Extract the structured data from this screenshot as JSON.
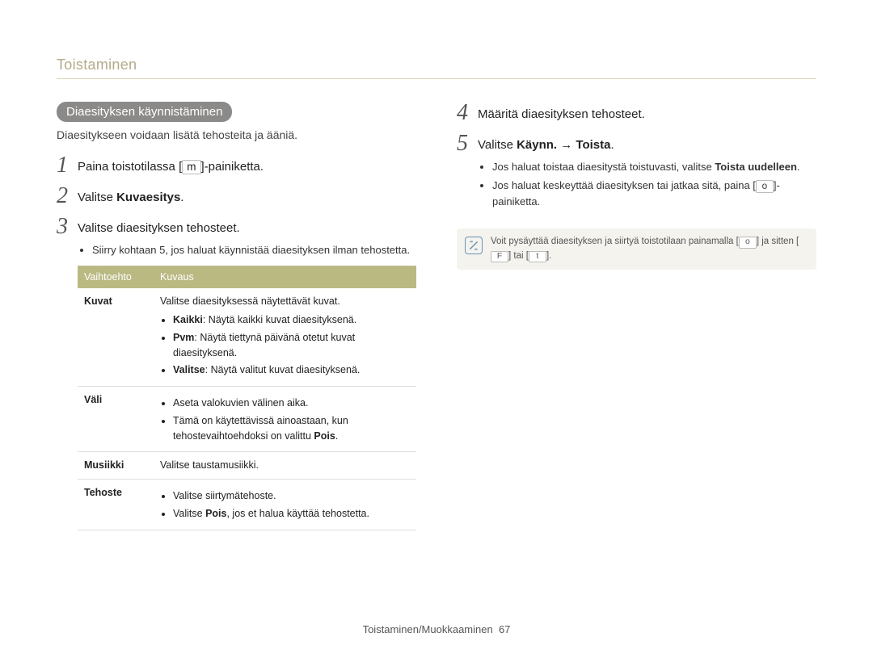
{
  "header": "Toistaminen",
  "left": {
    "pill": "Diaesityksen käynnistäminen",
    "intro": "Diaesitykseen voidaan lisätä tehosteita ja ääniä.",
    "step1_pre": "Paina toistotilassa [",
    "step1_key": "m",
    "step1_post": "]-painiketta.",
    "step2_pre": "Valitse ",
    "step2_bold": "Kuvaesitys",
    "step2_post": ".",
    "step3": "Valitse diaesityksen tehosteet.",
    "step3_bullet": "Siirry kohtaan 5, jos haluat käynnistää diaesityksen ilman tehostetta.",
    "table": {
      "head_option": "Vaihtoehto",
      "head_desc": "Kuvaus",
      "rows": [
        {
          "label": "Kuvat",
          "intro": "Valitse diaesityksessä näytettävät kuvat.",
          "items": [
            {
              "b": "Kaikki",
              "t": ": Näytä kaikki kuvat diaesityksenä."
            },
            {
              "b": "Pvm",
              "t": ": Näytä tiettynä päivänä otetut kuvat diaesityksenä."
            },
            {
              "b": "Valitse",
              "t": ": Näytä valitut kuvat diaesityksenä."
            }
          ]
        },
        {
          "label": "Väli",
          "items": [
            {
              "t": "Aseta valokuvien välinen aika."
            },
            {
              "t_pre": "Tämä on käytettävissä ainoastaan, kun tehostevaihtoehdoksi on valittu ",
              "b_trail": "Pois",
              "t_post": "."
            }
          ]
        },
        {
          "label": "Musiikki",
          "plain": "Valitse taustamusiikki."
        },
        {
          "label": "Tehoste",
          "items": [
            {
              "t": "Valitse siirtymätehoste."
            },
            {
              "t_pre": "Valitse ",
              "b_trail": "Pois",
              "t_post": ", jos et halua käyttää tehostetta."
            }
          ]
        }
      ]
    }
  },
  "right": {
    "step4": "Määritä diaesityksen tehosteet.",
    "step5_pre": "Valitse ",
    "step5_bold": "Käynn. → Toista",
    "step5_post": ".",
    "step5_b1_pre": "Jos haluat toistaa diaesitystä toistuvasti, valitse ",
    "step5_b1_bold": "Toista uudelleen",
    "step5_b1_post": ".",
    "step5_b2_pre": "Jos haluat keskeyttää diaesityksen tai jatkaa sitä, paina [",
    "step5_b2_key": "o",
    "step5_b2_post": "]-painiketta.",
    "note_pre": "Voit pysäyttää diaesityksen ja siirtyä toistotilaan painamalla [",
    "note_key1": "o",
    "note_mid": "] ja sitten [",
    "note_key2": "F",
    "note_mid2": "] tai [",
    "note_key3": "t",
    "note_post": "]."
  },
  "footer": {
    "text": "Toistaminen/Muokkaaminen",
    "page": "67"
  }
}
